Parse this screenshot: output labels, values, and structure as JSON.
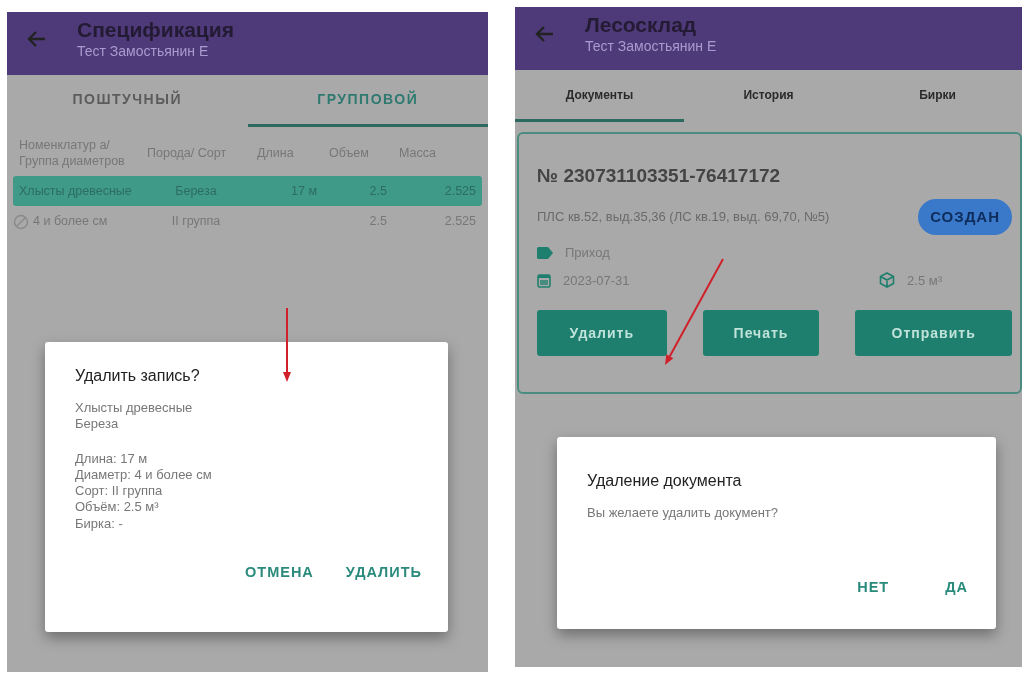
{
  "screens": [
    {
      "kind": "spec",
      "title": "Спецификация",
      "subtitle": "Тест Замостьянин Е",
      "tabs": [
        {
          "label": "ПОШТУЧНЫЙ",
          "selected": false
        },
        {
          "label": "ГРУППОВОЙ",
          "selected": true
        }
      ],
      "table": {
        "columns": [
          "Номенклатур а/ Группа диаметров",
          "Порода/ Сорт",
          "Длина",
          "Объем",
          "Масса"
        ],
        "rows": [
          {
            "kind": "group",
            "selected": true,
            "cells": [
              "Хлысты древесные",
              "Береза",
              "17 м",
              "2.5",
              "2.525"
            ]
          },
          {
            "kind": "item",
            "selected": false,
            "cells": [
              "4 и более см",
              "II группа",
              null,
              "2.5",
              "2.525"
            ]
          }
        ]
      },
      "dialog": {
        "title": "Удалить запись?",
        "paragraphs": [
          [
            "Хлысты древесные",
            "Береза"
          ],
          [
            "Длина: 17 м",
            "Диаметр: 4 и более см",
            "Сорт: II группа",
            "Объём: 2.5 м³",
            "Бирка: -"
          ]
        ],
        "buttons": [
          "ОТМЕНА",
          "УДАЛИТЬ"
        ]
      }
    },
    {
      "kind": "stock",
      "title": "Лесосклад",
      "subtitle": "Тест Замостьянин Е",
      "tabs": [
        {
          "label": "Документы",
          "selected": true
        },
        {
          "label": "История",
          "selected": false
        },
        {
          "label": "Бирки",
          "selected": false
        }
      ],
      "document": {
        "number": "№ 230731103351-76417172",
        "address": "ПЛС кв.52, выд.35,36 (ЛС кв.19, выд. 69,70, №5)",
        "status": "СОЗДАН",
        "type": "Приход",
        "date": "2023-07-31",
        "volume": "2.5 м³",
        "buttons": [
          "Удалить",
          "Печать",
          "Отправить"
        ]
      },
      "dialog": {
        "title": "Удаление документа",
        "paragraphs": [
          [
            "Вы желаете удалить документ?"
          ]
        ],
        "buttons": [
          "НЕТ",
          "ДА"
        ]
      }
    }
  ]
}
